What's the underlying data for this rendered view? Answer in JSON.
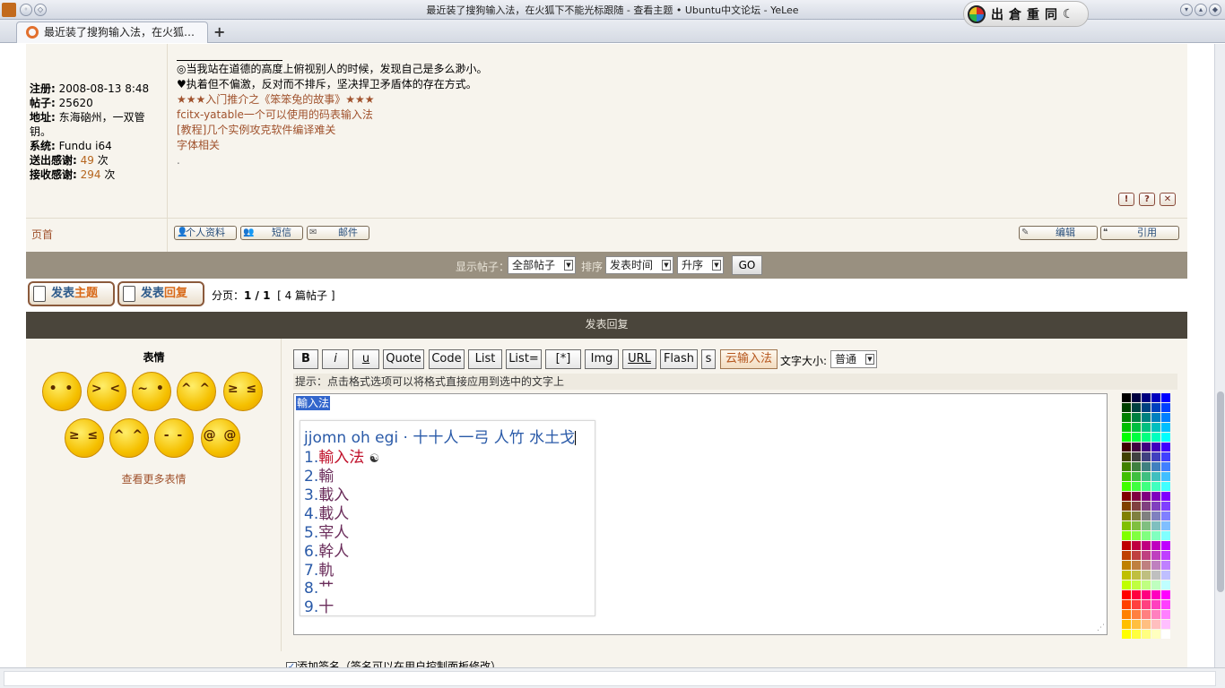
{
  "window": {
    "title": "最近装了搜狗输入法，在火狐下不能光标跟随 - 查看主题 • Ubuntu中文论坛 - YeLee",
    "tab_title": "最近装了搜狗输入法，在火狐…",
    "new_tab": "+"
  },
  "ime_tray": {
    "keys": [
      "出",
      "倉",
      "重",
      "同"
    ],
    "moon": "☾"
  },
  "profile": {
    "fields": [
      {
        "label": "注册:",
        "value": "2008-08-13 8:48"
      },
      {
        "label": "帖子:",
        "value": "25620"
      },
      {
        "label": "地址:",
        "value": "东海硇州，一双管钥。"
      },
      {
        "label": "系统:",
        "value": "Fundu i64"
      }
    ],
    "thanks_sent_label": "送出感谢:",
    "thanks_sent_count": "49",
    "thanks_received_label": "接收感谢:",
    "thanks_received_count": "294",
    "times_unit": "次"
  },
  "signature": {
    "lines": [
      "◎当我站在道德的高度上俯视别人的时候，发现自己是多么渺小。",
      "♥执着但不偏激，反对而不排斥，坚决捍卫矛盾体的存在方式。"
    ],
    "links": [
      "★★★入门推介之《笨笨兔的故事》★★★",
      "fcitx-yatable一个可以使用的码表输入法",
      "[教程]几个实例攻克软件编译难关",
      "字体相关"
    ],
    "dot": "."
  },
  "post_icons": [
    "!",
    "?",
    "✕"
  ],
  "post_footer": {
    "top_link": "页首",
    "profile_btn": "个人资料",
    "pm_btn": "短信",
    "email_btn": "邮件",
    "edit_btn": "编辑",
    "quote_btn": "引用"
  },
  "filter": {
    "show_label": "显示帖子：",
    "show_value": "全部帖子",
    "sort_label": "排序",
    "sort_value": "发表时间",
    "order_value": "升序",
    "go": "GO"
  },
  "actions": {
    "new_topic_a": "发表",
    "new_topic_b": "主题",
    "reply_a": "发表",
    "reply_b": "回复",
    "paging_label": "分页：",
    "paging_value": "1 / 1",
    "post_count": "[ 4 篇帖子 ]"
  },
  "reply": {
    "header": "发表回复",
    "emoticons_title": "表情",
    "more_emoticons": "查看更多表情",
    "toolbar": [
      "B",
      "i",
      "u",
      "Quote",
      "Code",
      "List",
      "List=",
      "[*]",
      "Img",
      "URL",
      "Flash",
      "s",
      "云输入法"
    ],
    "font_size_label": "文字大小:",
    "font_size_value": "普通",
    "hint": "提示：点击格式选项可以将格式直接应用到选中的文字上",
    "selected_text": "輸入法",
    "attach_sig": "添加签名（签名可以在用户控制面板修改）"
  },
  "ime": {
    "preedit": "jjomn oh egi · 十十人一弓 人竹 水土戈",
    "candidates": [
      {
        "idx": "1.",
        "text": "輸入法",
        "yin": "☯"
      },
      {
        "idx": "2.",
        "text": "輸"
      },
      {
        "idx": "3.",
        "text": "載入"
      },
      {
        "idx": "4.",
        "text": "載人"
      },
      {
        "idx": "5.",
        "text": "宰人"
      },
      {
        "idx": "6.",
        "text": "幹人"
      },
      {
        "idx": "7.",
        "text": "軌"
      },
      {
        "idx": "8.",
        "text": "艹"
      },
      {
        "idx": "9.",
        "text": "十"
      }
    ]
  },
  "colors": {
    "filter_bar": "#999080",
    "reply_header": "#4a453b",
    "post_bg": "#f7f4ed",
    "link": "#a0522d",
    "accent_blue": "#2d5a8a"
  }
}
